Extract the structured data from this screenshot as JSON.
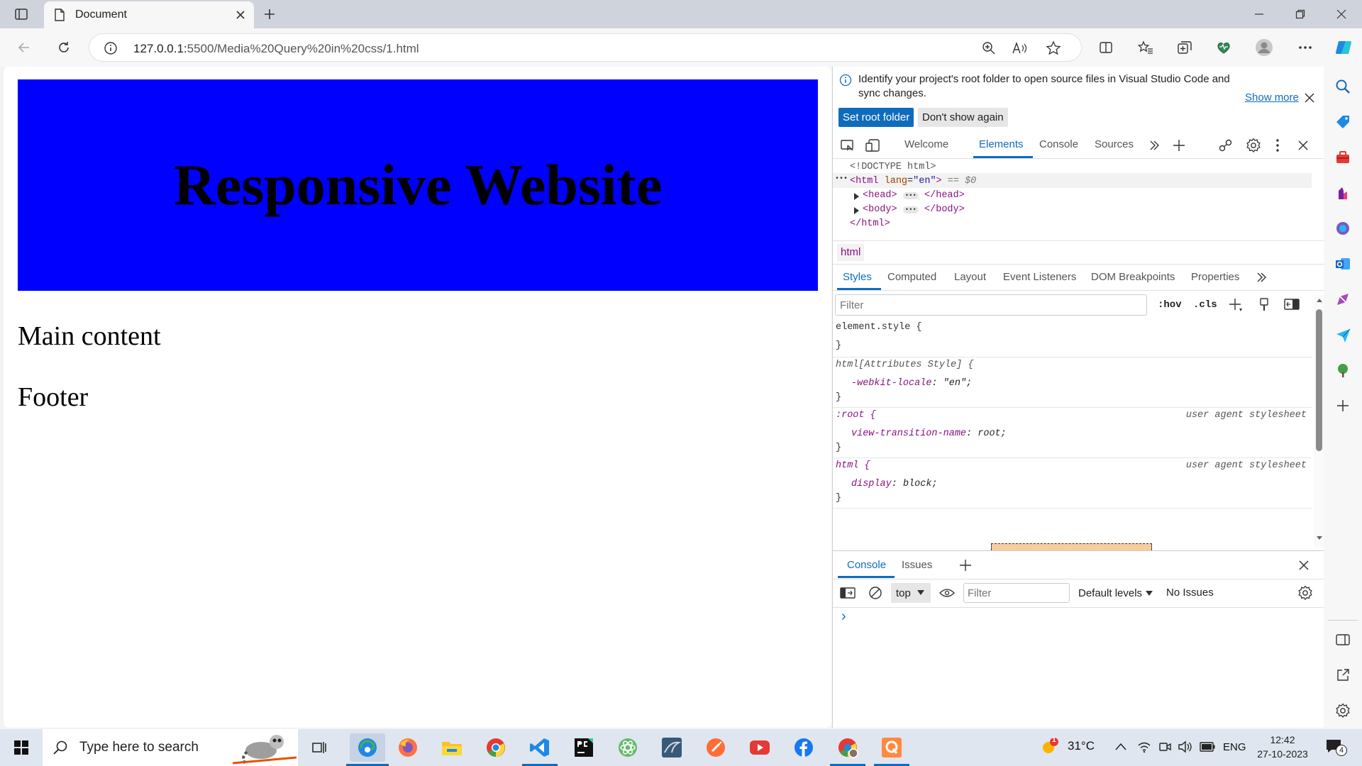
{
  "browser": {
    "tab_title": "Document",
    "url_host": "127.0.0.1:",
    "url_path": "5500/Media%20Query%20in%20css/1.html"
  },
  "page": {
    "heading": "Responsive Website",
    "main": "Main content",
    "footer": "Footer",
    "banner_color": "#0000ff"
  },
  "devtools": {
    "info_text_1": "Identify your project's root folder to open source files in Visual Studio Code and",
    "info_text_2": "sync changes.",
    "show_more": "Show more",
    "set_root": "Set root folder",
    "dont_show": "Don't show again",
    "tabs": [
      "Welcome",
      "Elements",
      "Console",
      "Sources"
    ],
    "dom": {
      "doctype": "<!DOCTYPE html>",
      "html_open": "<html",
      "lang_attr": "lang",
      "lang_val": "\"en\"",
      "close_bracket": ">",
      "eq": "== $0",
      "head_open": "<head>",
      "head_close": "</head>",
      "body_open": "<body>",
      "body_close": "</body>",
      "html_close": "</html>",
      "ellipsis": "•••"
    },
    "breadcrumb": "html",
    "subtabs": [
      "Styles",
      "Computed",
      "Layout",
      "Event Listeners",
      "DOM Breakpoints",
      "Properties"
    ],
    "filter_placeholder": "Filter",
    "hov": ":hov",
    "cls": ".cls",
    "styles": {
      "r1_sel": "element.style {",
      "close": "}",
      "r2_sel": "html[Attributes Style] {",
      "r2_prop": "-webkit-locale",
      "r2_val": "\"en\";",
      "r3_sel": ":root {",
      "r3_prop": "view-transition-name",
      "r3_val": "root;",
      "r4_sel": "html {",
      "r4_prop": "display",
      "r4_val": "block;",
      "uas": "user agent stylesheet",
      "colon": ":"
    },
    "drawer": {
      "tabs": [
        "Console",
        "Issues"
      ],
      "context": "top",
      "filter_placeholder": "Filter",
      "levels": "Default levels",
      "issues": "No Issues",
      "prompt": "›"
    }
  },
  "taskbar": {
    "search_placeholder": "Type here to search",
    "temp": "31°C",
    "lang": "ENG",
    "time": "12:42",
    "date": "27-10-2023",
    "notif_count": "4",
    "weather_badge": "1"
  }
}
